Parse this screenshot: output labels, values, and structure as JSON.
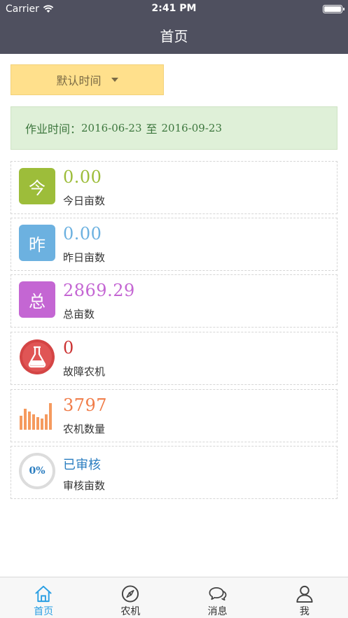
{
  "status_bar": {
    "carrier": "Carrier",
    "time": "2:41 PM"
  },
  "nav": {
    "title": "首页"
  },
  "filter": {
    "label": "默认时间"
  },
  "range": {
    "label": "作业时间：",
    "start": "2016-06-23",
    "separator": "至",
    "end": "2016-09-23"
  },
  "cards": [
    {
      "badge": "今",
      "value": "0.00",
      "label": "今日亩数",
      "color": "#9dbd3a"
    },
    {
      "badge": "昨",
      "value": "0.00",
      "label": "昨日亩数",
      "color": "#6cb1e0"
    },
    {
      "badge": "总",
      "value": "2869.29",
      "label": "总亩数",
      "color": "#c466d3"
    },
    {
      "value": "0",
      "label": "故障农机",
      "color": "#cc3333"
    },
    {
      "value": "3797",
      "label": "农机数量",
      "color": "#f07c48"
    },
    {
      "ring_label": "0%",
      "value": "已审核",
      "label": "审核亩数",
      "color": "#2a7dc0"
    }
  ],
  "tabs": [
    {
      "label": "首页",
      "icon": "home-icon",
      "active": true
    },
    {
      "label": "农机",
      "icon": "compass-icon",
      "active": false
    },
    {
      "label": "消息",
      "icon": "chat-bubbles-icon",
      "active": false
    },
    {
      "label": "我",
      "icon": "user-icon",
      "active": false
    }
  ],
  "colors": {
    "nav_bg": "#4f505f",
    "accent": "#2a9fe3",
    "filter_bg": "#ffe08c",
    "range_bg": "#dff0d8"
  }
}
